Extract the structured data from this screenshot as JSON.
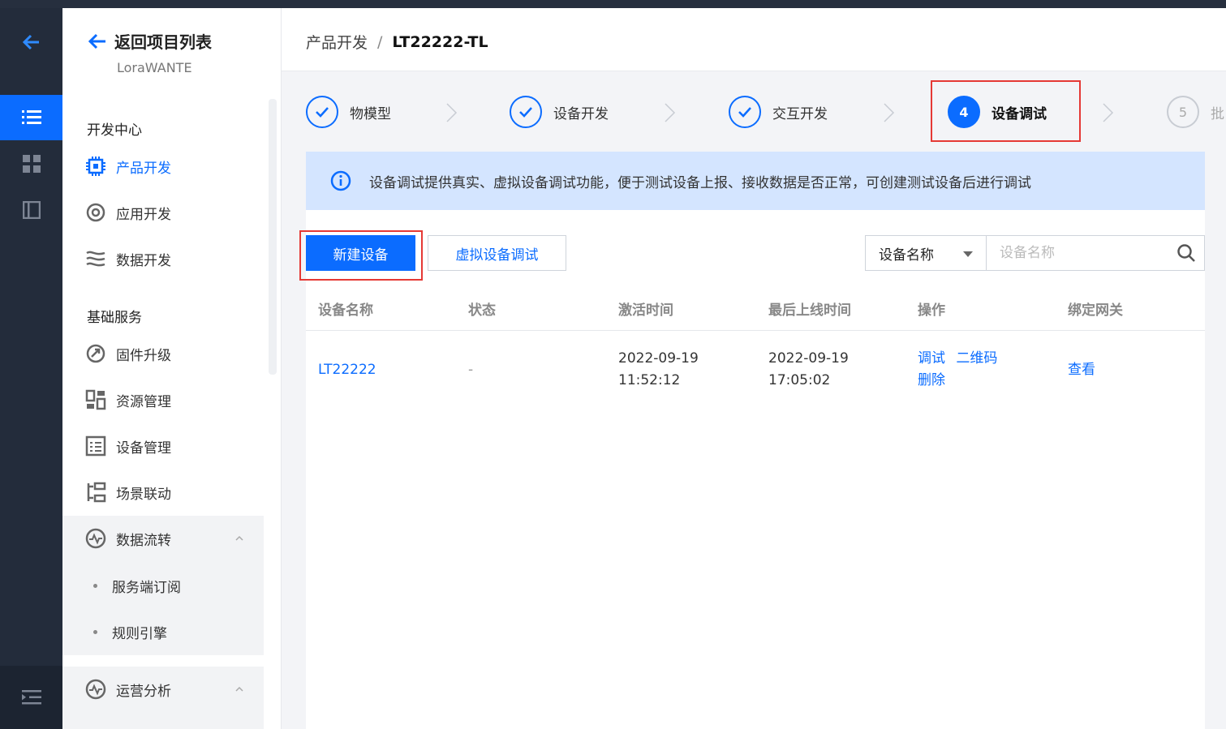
{
  "sidebar": {
    "back_label": "返回项目列表",
    "project_name": "LoraWANTE",
    "section_dev": "开发中心",
    "section_basic": "基础服务",
    "dev_items": [
      {
        "label": "产品开发",
        "icon": "cpu-icon",
        "active": true
      },
      {
        "label": "应用开发",
        "icon": "app-icon"
      },
      {
        "label": "数据开发",
        "icon": "data-flow-icon"
      }
    ],
    "basic_items": [
      {
        "label": "固件升级",
        "icon": "firmware-icon"
      },
      {
        "label": "资源管理",
        "icon": "resource-icon"
      },
      {
        "label": "设备管理",
        "icon": "device-list-icon"
      },
      {
        "label": "场景联动",
        "icon": "scene-icon"
      }
    ],
    "data_flow": {
      "label": "数据流转",
      "children": [
        "服务端订阅",
        "规则引擎"
      ]
    },
    "ops_analysis": {
      "label": "运营分析"
    }
  },
  "header": {
    "crumb_parent": "产品开发",
    "separator": "/",
    "crumb_current": "LT22222-TL"
  },
  "steps": [
    {
      "label": "物模型",
      "state": "done"
    },
    {
      "label": "设备开发",
      "state": "done"
    },
    {
      "label": "交互开发",
      "state": "done"
    },
    {
      "number": "4",
      "label": "设备调试",
      "state": "current"
    },
    {
      "number": "5",
      "label": "批",
      "state": "todo"
    }
  ],
  "notice": {
    "text": "设备调试提供真实、虚拟设备调试功能，便于测试设备上报、接收数据是否正常，可创建测试设备后进行调试"
  },
  "toolbar": {
    "new_device": "新建设备",
    "virtual_debug": "虚拟设备调试",
    "search_field": "设备名称",
    "search_placeholder": "设备名称"
  },
  "table": {
    "columns": [
      "设备名称",
      "状态",
      "激活时间",
      "最后上线时间",
      "操作",
      "绑定网关"
    ],
    "rows": [
      {
        "name": "LT22222",
        "status": "-",
        "activated_date": "2022-09-19",
        "activated_time": "11:52:12",
        "last_online_date": "2022-09-19",
        "last_online_time": "17:05:02",
        "actions": [
          "调试",
          "二维码",
          "删除"
        ],
        "gateway": "查看"
      }
    ]
  },
  "colors": {
    "primary": "#0b6cff",
    "rail_bg": "#232c3b",
    "highlight": "#e53935",
    "notice_bg": "#d4e5ff"
  }
}
